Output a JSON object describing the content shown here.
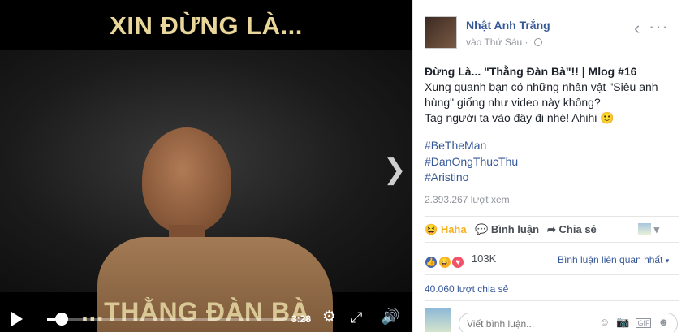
{
  "video": {
    "caption_top": "XIN ĐỪNG LÀ...",
    "caption_bottom": "...THẰNG ĐÀN BÀ",
    "time": "3:28",
    "progress": 0.03
  },
  "post": {
    "author": "Nhật Anh Trắng",
    "time": "vào Thứ Sáu",
    "separator": "·",
    "title": "Đừng Là... \"Thằng Đàn Bà\"!! | Mlog #16",
    "line1": "Xung quanh bạn có những nhân vật \"Siêu anh hùng\" giống như video này không?",
    "line2": "Tag người ta vào đây đi nhé! Ahihi 🙂",
    "hashtags": [
      "#BeTheMan",
      "#DanOngThucThu",
      "#Aristino"
    ],
    "views": "2.393.267 lượt xem"
  },
  "actions": {
    "reaction": "Haha",
    "comment": "Bình luận",
    "share": "Chia sẻ"
  },
  "stats": {
    "reaction_count": "103K",
    "sort_label": "Bình luận liên quan nhất",
    "shares": "40.060 lượt chia sẻ"
  },
  "comment": {
    "placeholder": "Viết bình luận..."
  },
  "icons": [
    "play-icon",
    "settings-icon",
    "fullscreen-icon",
    "volume-icon",
    "next-icon",
    "globe-icon",
    "like-icon",
    "haha-icon",
    "love-icon",
    "comment-icon",
    "share-icon",
    "emoji-icon",
    "camera-icon",
    "gif-icon",
    "sticker-icon"
  ]
}
